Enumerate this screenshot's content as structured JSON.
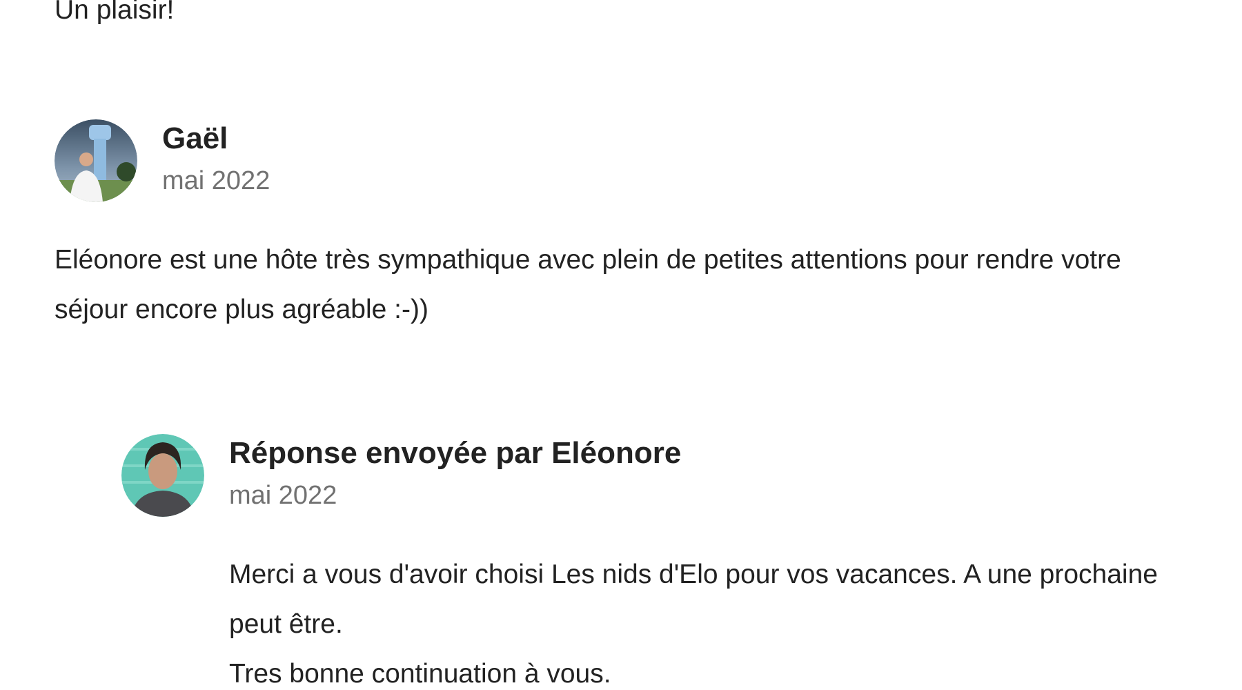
{
  "previous_review": {
    "text": "Un plaisir!"
  },
  "review": {
    "author": "Gaël",
    "date": "mai 2022",
    "text": "Eléonore est une hôte très sympathique avec plein de petites attentions pour rendre votre séjour encore plus agréable :-))"
  },
  "host_reply": {
    "heading": "Réponse envoyée par Eléonore",
    "date": "mai 2022",
    "lines": [
      "Merci a vous d'avoir choisi Les nids d'Elo pour vos vacances. A une prochaine peut être.",
      "Tres bonne continuation à vous."
    ]
  },
  "colors": {
    "text": "#222222",
    "muted": "#717171",
    "background": "#ffffff"
  }
}
